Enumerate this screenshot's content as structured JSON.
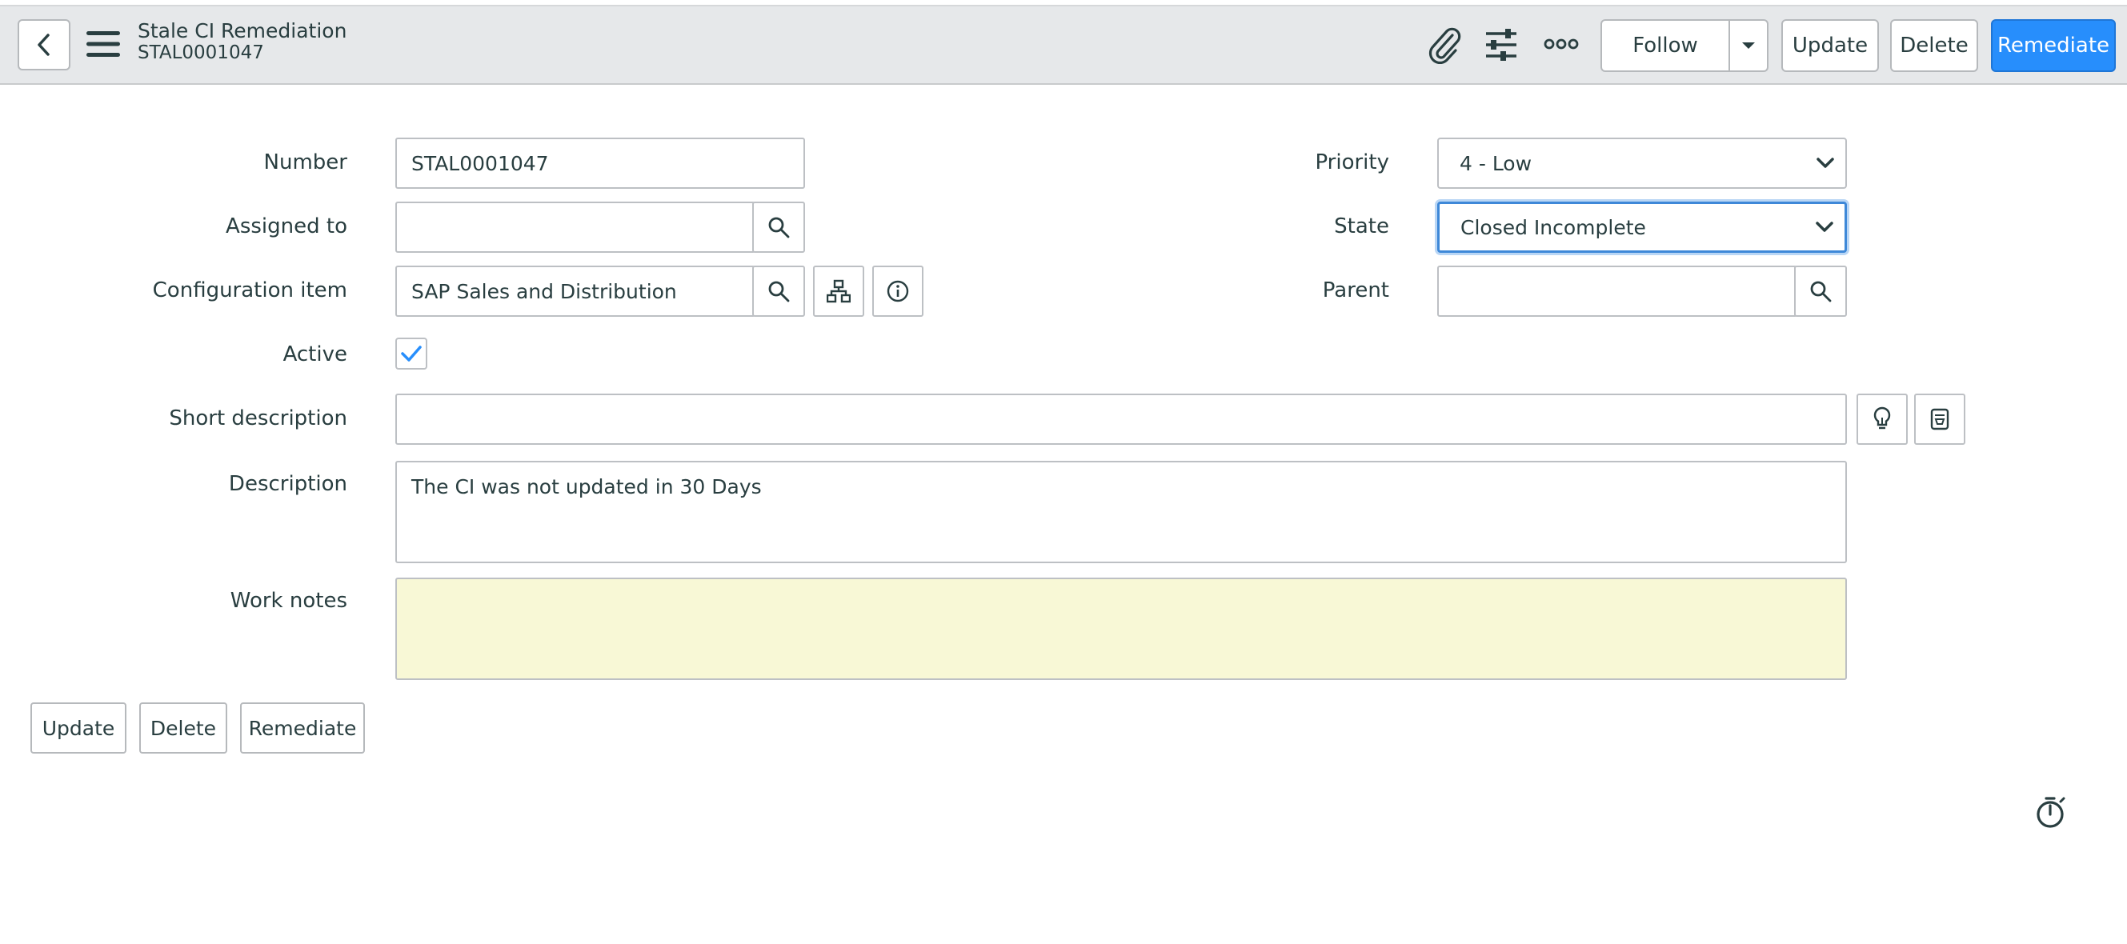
{
  "header": {
    "title": "Stale CI Remediation",
    "record_number": "STAL0001047",
    "follow_label": "Follow",
    "update_label": "Update",
    "delete_label": "Delete",
    "remediate_label": "Remediate"
  },
  "form": {
    "number": {
      "label": "Number",
      "value": "STAL0001047"
    },
    "assigned_to": {
      "label": "Assigned to",
      "value": ""
    },
    "configuration_item": {
      "label": "Configuration item",
      "value": "SAP Sales and Distribution"
    },
    "active": {
      "label": "Active",
      "checked": true
    },
    "short_description": {
      "label": "Short description",
      "value": ""
    },
    "description": {
      "label": "Description",
      "value": "The CI was not updated in 30 Days"
    },
    "work_notes": {
      "label": "Work notes",
      "value": ""
    },
    "priority": {
      "label": "Priority",
      "value": "4 - Low"
    },
    "state": {
      "label": "State",
      "value": "Closed Incomplete"
    },
    "parent": {
      "label": "Parent",
      "value": ""
    }
  },
  "footer": {
    "update_label": "Update",
    "delete_label": "Delete",
    "remediate_label": "Remediate"
  },
  "colors": {
    "primary": "#278efc",
    "header_bg": "#e6e8ea",
    "work_notes_bg": "#f8f8d6",
    "focus": "#3e88d8"
  }
}
